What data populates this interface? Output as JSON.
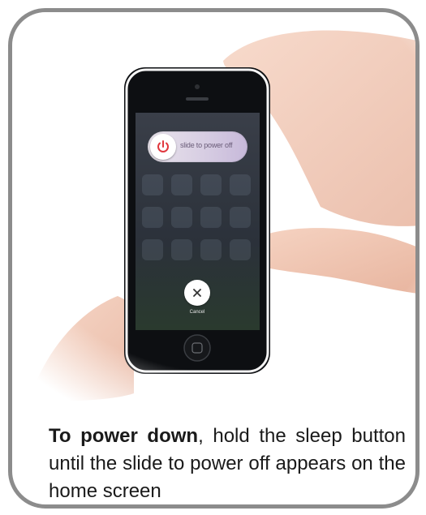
{
  "phone": {
    "slider_label": "slide to power off",
    "cancel_label": "Cancel",
    "icons": [
      "power-icon",
      "close-icon"
    ]
  },
  "caption": {
    "bold": "To power down",
    "rest": ", hold the sleep button until the slide to power off appears on the home screen"
  },
  "colors": {
    "frame_border": "#8c8c8c",
    "power_red": "#e0383e",
    "slider_purple": "#c7b9da",
    "skin": "#f0c7b4"
  }
}
